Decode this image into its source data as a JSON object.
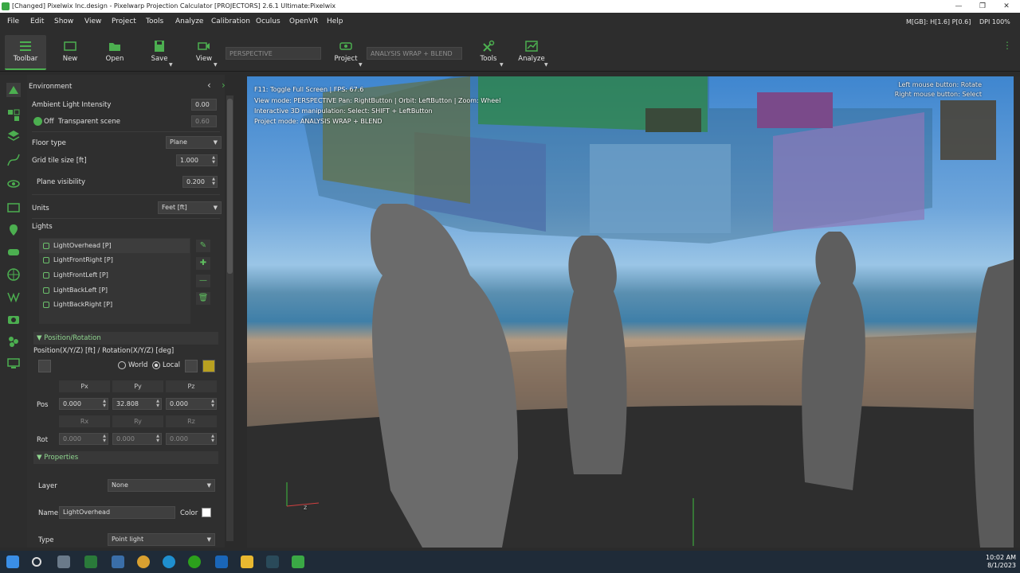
{
  "window": {
    "title": "[Changed] Pixelwix Inc.design - Pixelwarp Projection Calculator [PROJECTORS] 2.6.1 Ultimate:Pixelwix"
  },
  "menu": {
    "items": [
      "File",
      "Edit",
      "Show",
      "View",
      "Project",
      "Tools",
      "Analyze",
      "Calibration",
      "Oculus",
      "OpenVR",
      "Help"
    ],
    "memory": "M[GB]: H[1.6] P[0.6]",
    "dpi": "DPI 100%"
  },
  "toolbar": {
    "toolbar_label": "Toolbar",
    "new_label": "New",
    "open_label": "Open",
    "save_label": "Save",
    "view_label": "View",
    "view_mode": "PERSPECTIVE",
    "project_label": "Project",
    "project_mode": "ANALYSIS WRAP + BLEND",
    "tools_label": "Tools",
    "analyze_label": "Analyze"
  },
  "panel": {
    "title": "Environment",
    "ambient_label": "Ambient Light Intensity",
    "ambient_value": "0.00",
    "transparent_toggle": "Off",
    "transparent_label": "Transparent scene",
    "transparent_value": "0.60",
    "floor_label": "Floor type",
    "floor_value": "Plane",
    "grid_label": "Grid tile size  [ft]",
    "grid_value": "1.000",
    "plane_label": "Plane visibility",
    "plane_value": "0.200",
    "units_label": "Units",
    "units_value": "Feet [ft]",
    "lights_label": "Lights",
    "lights": [
      "LightOverhead [P]",
      "LightFrontRight [P]",
      "LightFrontLeft [P]",
      "LightBackLeft [P]",
      "LightBackRight [P]"
    ],
    "posrot_section": "Position/Rotation",
    "posrot_label": "Position(X/Y/Z) [ft] / Rotation(X/Y/Z) [deg]",
    "world_label": "World",
    "local_label": "Local",
    "pos_headers": [
      "Px",
      "Py",
      "Pz"
    ],
    "pos_label": "Pos",
    "pos_values": [
      "0.000",
      "32.808",
      "0.000"
    ],
    "rot_headers": [
      "Rx",
      "Ry",
      "Rz"
    ],
    "rot_label": "Rot",
    "rot_values": [
      "0.000",
      "0.000",
      "0.000"
    ],
    "properties_section": "Properties",
    "layer_label": "Layer",
    "layer_value": "None",
    "name_label": "Name",
    "name_value": "LightOverhead",
    "color_label": "Color",
    "type_label": "Type",
    "type_value": "Point light"
  },
  "viewport": {
    "line1": "F11: Toggle Full Screen | FPS: 67.6",
    "line2": "View mode: PERSPECTIVE Pan: RightButton | Orbit: LeftButton | Zoom: Wheel",
    "line3": "Interactive 3D manipulation: Select: SHIFT + LeftButton",
    "line4": "Project mode: ANALYSIS WRAP + BLEND",
    "hint1": "Left mouse button: Rotate",
    "hint2": "Right mouse button: Select",
    "axis_z": "z"
  },
  "taskbar": {
    "time": "10:02 AM",
    "date": "8/1/2023"
  },
  "colors": {
    "accent": "#4caf50",
    "panel": "#2f2f2f",
    "taskbar": "#1f2b38"
  }
}
